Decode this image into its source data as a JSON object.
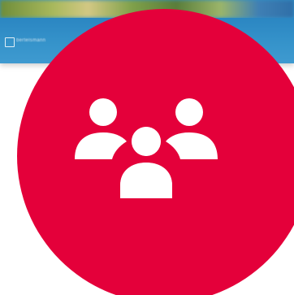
{
  "banner": {
    "org_text": "bertelsmann"
  },
  "badge": {
    "icon": "people-group-icon",
    "background_color": "#e4003a",
    "icon_color": "#ffffff"
  }
}
